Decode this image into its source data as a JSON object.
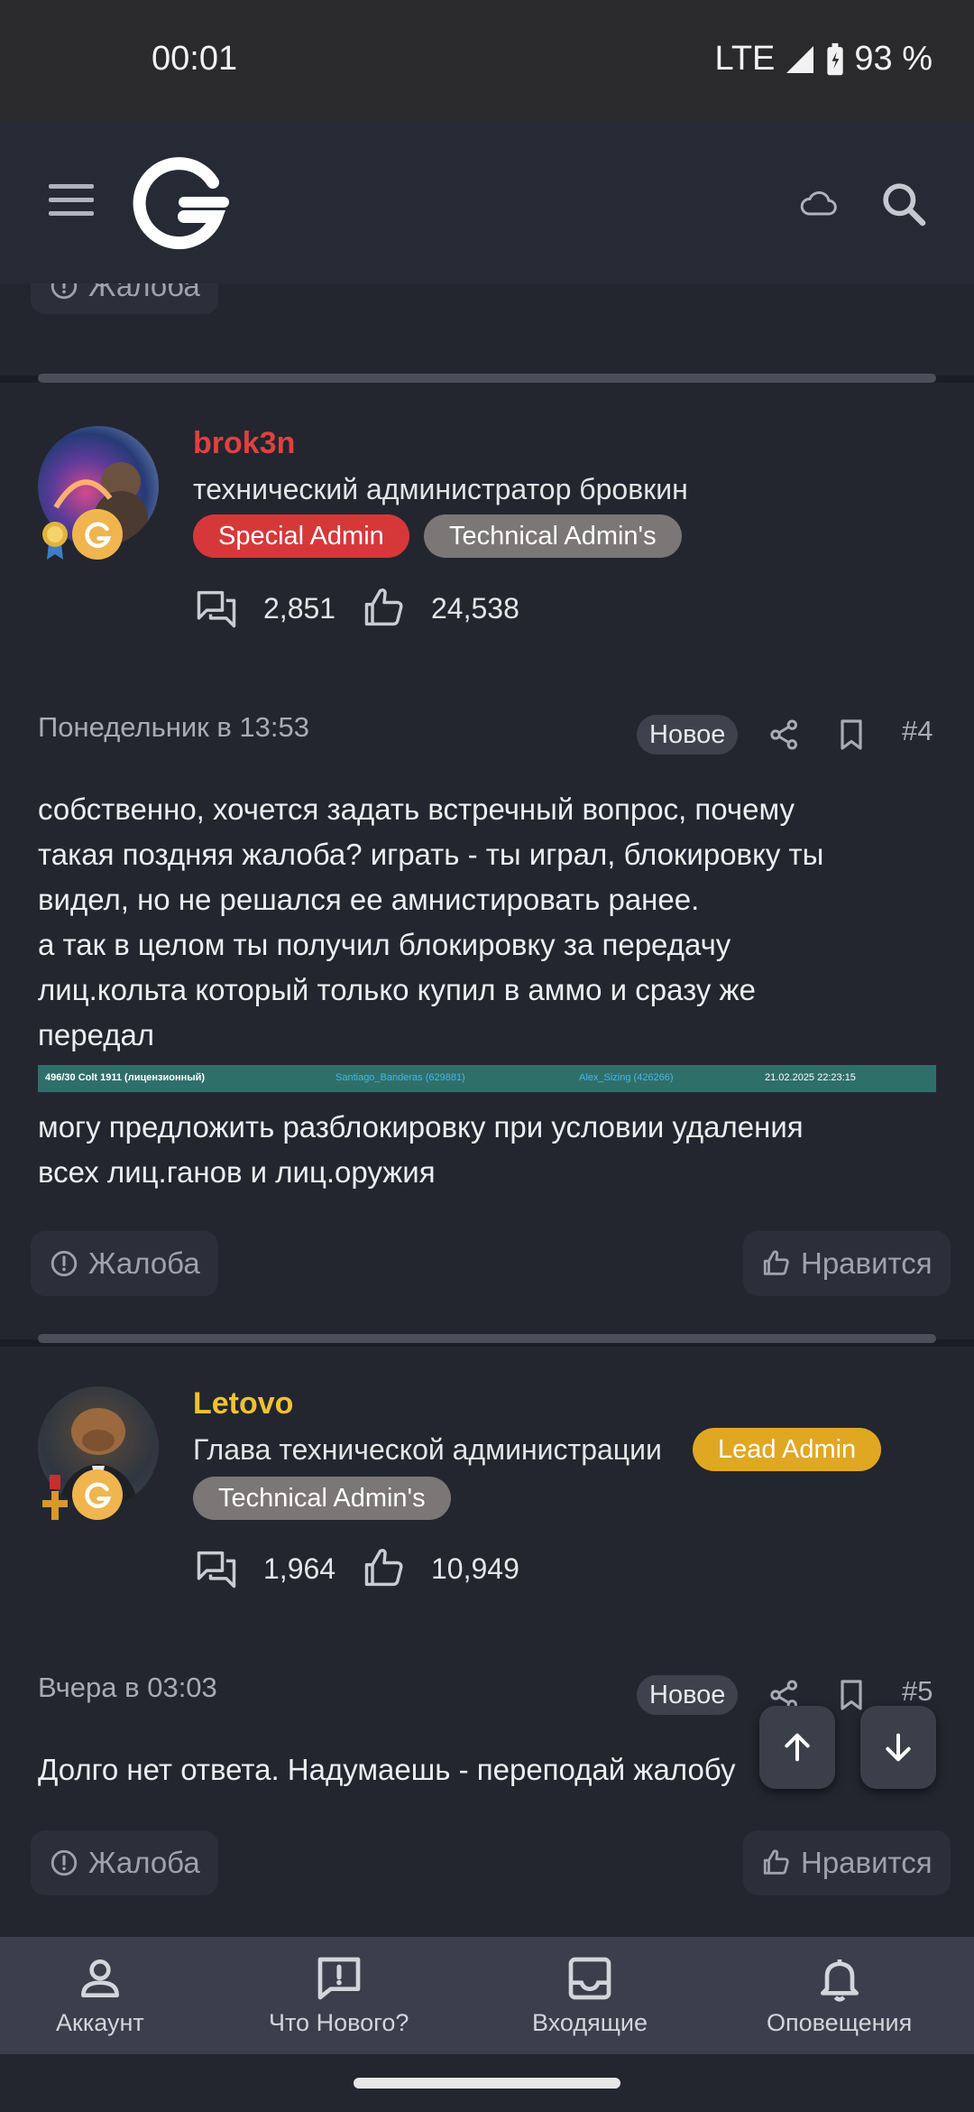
{
  "status_bar": {
    "time": "00:01",
    "network": "LTE",
    "battery": "93 %"
  },
  "app_bar": {
    "logo_alt": "G"
  },
  "top_complaint": {
    "label": "Жалоба"
  },
  "posts": [
    {
      "username": "brok3n",
      "username_color": "#e0413f",
      "user_title": "технический администратор бровкин",
      "tags": [
        "Special Admin",
        "Technical Admin's"
      ],
      "messages": "2,851",
      "reactions": "24,538",
      "date": "Понедельник в 13:53",
      "new_label": "Новое",
      "number": "#4",
      "text_lines": [
        "собственно, хочется задать встречный вопрос, почему",
        "такая поздняя жалоба? играть - ты играл, блокировку ты",
        "видел, но не решался ее амнистировать ранее.",
        "а так в целом ты получил блокировку за передачу",
        "лиц.кольта который только купил в аммо и сразу же",
        "передал"
      ],
      "attachment_row": [
        "496/30 Colt 1911 (лицензионный)",
        "Santiago_Banderas (629881)",
        "Alex_Sizing (426266)",
        "21.02.2025 22:23:15"
      ],
      "text_lines_2": [
        "могу предложить разблокировку при условии удаления",
        "всех лиц.ганов и лиц.оружия"
      ],
      "complaint_label": "Жалоба",
      "like_label": "Нравится"
    },
    {
      "username": "Letovo",
      "username_color": "#f0c232",
      "user_title": "Глава технической администрации",
      "tags": [
        "Lead Admin",
        "Technical Admin's"
      ],
      "messages": "1,964",
      "reactions": "10,949",
      "date": "Вчера в 03:03",
      "new_label": "Новое",
      "number": "#5",
      "text_lines": [
        "Долго нет ответа. Надумаешь - переподай жалобу"
      ],
      "complaint_label": "Жалоба",
      "like_label": "Нравится"
    }
  ],
  "bottom_nav": [
    {
      "label": "Аккаунт",
      "icon": "account-icon"
    },
    {
      "label": "Что Нового?",
      "icon": "whats-new-icon"
    },
    {
      "label": "Входящие",
      "icon": "inbox-icon"
    },
    {
      "label": "Оповещения",
      "icon": "bell-icon"
    }
  ]
}
